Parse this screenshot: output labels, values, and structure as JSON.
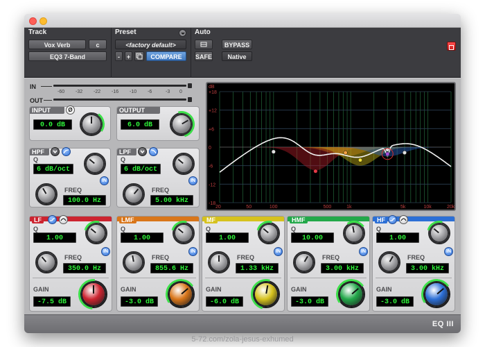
{
  "app": {
    "badge": "EQ III"
  },
  "header": {
    "track_label": "Track",
    "track_name": "Vox Verb",
    "track_channel": "c",
    "insert_name": "EQ3 7-Band",
    "preset_label": "Preset",
    "preset_name": "<factory default>",
    "preset_minus": "-",
    "preset_plus": "+",
    "compare": "COMPARE",
    "auto_label": "Auto",
    "bypass": "BYPASS",
    "safe": "SAFE",
    "native": "Native"
  },
  "meter": {
    "in_label": "IN",
    "out_label": "OUT",
    "scale": [
      "-60",
      "-32",
      "-22",
      "-16",
      "-10",
      "-6",
      "-3",
      "0"
    ]
  },
  "io": {
    "input_label": "INPUT",
    "input_value": "0.0 dB",
    "phase_symbol": "Ø",
    "output_label": "OUTPUT",
    "output_value": "6.0 dB"
  },
  "filters": {
    "hpf": {
      "label": "HPF",
      "q_label": "Q",
      "slope": "6 dB/oct",
      "freq_label": "FREQ",
      "freq": "100.0 Hz",
      "in_label": "IN"
    },
    "lpf": {
      "label": "LPF",
      "q_label": "Q",
      "slope": "6 dB/oct",
      "freq_label": "FREQ",
      "freq": "5.00 kHz",
      "in_label": "IN"
    }
  },
  "bands": [
    {
      "tag": "LF",
      "color": "#cc2430",
      "q_label": "Q",
      "q": "1.00",
      "freq_label": "FREQ",
      "freq": "350.0 Hz",
      "gain_label": "GAIN",
      "gain": "-7.5 dB",
      "in_label": "IN"
    },
    {
      "tag": "LMF",
      "color": "#d9761a",
      "q_label": "Q",
      "q": "1.00",
      "freq_label": "FREQ",
      "freq": "855.6 Hz",
      "gain_label": "GAIN",
      "gain": "-3.0 dB",
      "in_label": "IN"
    },
    {
      "tag": "MF",
      "color": "#d6c21e",
      "q_label": "Q",
      "q": "1.00",
      "freq_label": "FREQ",
      "freq": "1.33 kHz",
      "gain_label": "GAIN",
      "gain": "-6.0 dB",
      "in_label": "IN"
    },
    {
      "tag": "HMF",
      "color": "#23a84a",
      "q_label": "Q",
      "q": "10.00",
      "freq_label": "FREQ",
      "freq": "3.00 kHz",
      "gain_label": "GAIN",
      "gain": "-3.0 dB",
      "in_label": "IN"
    },
    {
      "tag": "HF",
      "color": "#2c6fd6",
      "q_label": "Q",
      "q": "1.00",
      "freq_label": "FREQ",
      "freq": "3.00 kHz",
      "gain_label": "GAIN",
      "gain": "-3.0 dB",
      "in_label": "IN"
    }
  ],
  "graph": {
    "unit": "dB",
    "db_ticks": [
      "+18",
      "+12",
      "+6",
      "0",
      "-6",
      "-12",
      "-18"
    ],
    "freq_ticks": [
      "20",
      "50",
      "100",
      "500",
      "1k",
      "5k",
      "10k",
      "20k"
    ]
  },
  "caption": "5-72.com/zola-jesus-exhumed"
}
